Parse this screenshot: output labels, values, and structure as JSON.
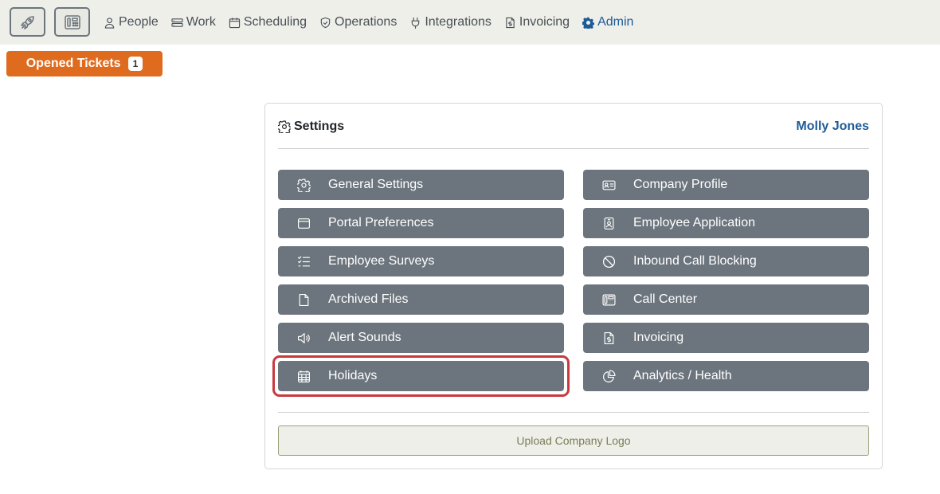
{
  "topbar": {
    "launch_icon": "rocket-icon",
    "call_center_icon": "fax-icon",
    "nav": [
      {
        "label": "People",
        "icon": "person-icon"
      },
      {
        "label": "Work",
        "icon": "stack-icon"
      },
      {
        "label": "Scheduling",
        "icon": "calendar-icon"
      },
      {
        "label": "Operations",
        "icon": "shield-check-icon"
      },
      {
        "label": "Integrations",
        "icon": "plug-icon"
      },
      {
        "label": "Invoicing",
        "icon": "file-dollar-icon"
      },
      {
        "label": "Admin",
        "icon": "gear-icon",
        "active": true
      }
    ]
  },
  "tickets": {
    "label": "Opened Tickets",
    "count": "1"
  },
  "settings": {
    "title": "Settings",
    "user": "Molly Jones",
    "left": [
      {
        "label": "General Settings",
        "icon": "gear-icon"
      },
      {
        "label": "Portal Preferences",
        "icon": "window-icon"
      },
      {
        "label": "Employee Surveys",
        "icon": "checklist-icon"
      },
      {
        "label": "Archived Files",
        "icon": "file-icon"
      },
      {
        "label": "Alert Sounds",
        "icon": "speaker-icon"
      },
      {
        "label": "Holidays",
        "icon": "calendar-grid-icon",
        "highlighted": true
      }
    ],
    "right": [
      {
        "label": "Company Profile",
        "icon": "id-card-icon"
      },
      {
        "label": "Employee Application",
        "icon": "person-badge-icon"
      },
      {
        "label": "Inbound Call Blocking",
        "icon": "block-icon"
      },
      {
        "label": "Call Center",
        "icon": "fax-icon"
      },
      {
        "label": "Invoicing",
        "icon": "file-dollar-icon"
      },
      {
        "label": "Analytics / Health",
        "icon": "pie-chart-icon"
      }
    ],
    "upload_label": "Upload Company Logo"
  },
  "colors": {
    "accent": "#1d5b97",
    "tickets_orange": "#df6b1f",
    "settings_button": "#6c757d",
    "highlight_red": "#c8393e"
  }
}
